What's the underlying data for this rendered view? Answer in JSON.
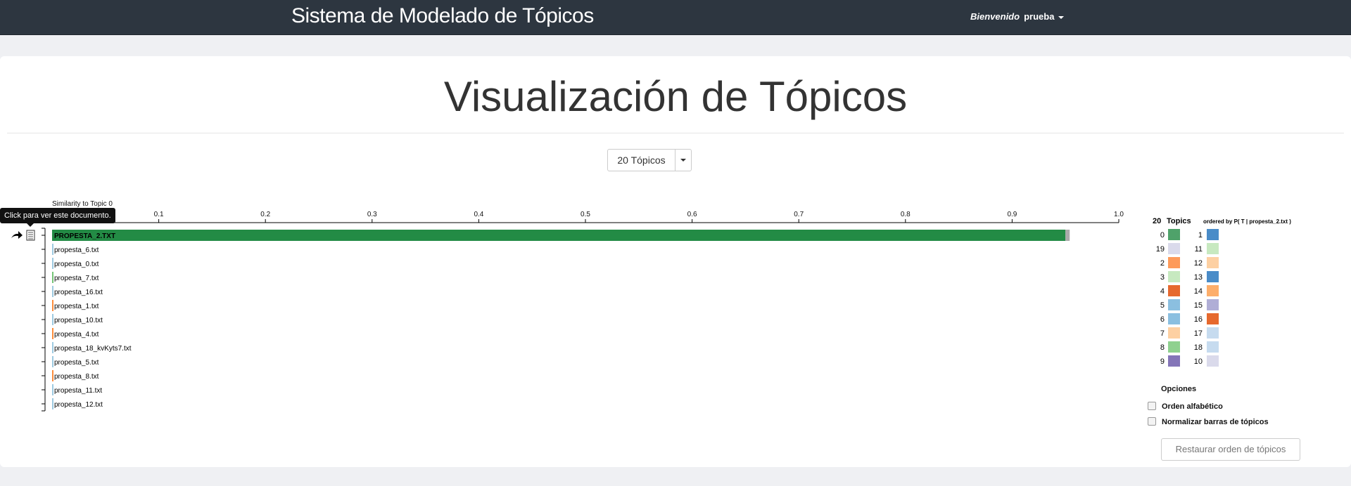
{
  "navbar": {
    "brand": "Sistema de Modelado de Tópicos",
    "welcome": "Bienvenido",
    "username": "prueba"
  },
  "page": {
    "title": "Visualización de Tópicos"
  },
  "topic_selector": {
    "selected": "20 Tópicos"
  },
  "tooltip": "Click para ver este documento.",
  "options": {
    "title": "Opciones",
    "alphabetical": "Orden alfabético",
    "normalize": "Normalizar barras de tópicos",
    "restore": "Restaurar orden de tópicos"
  },
  "colors": {
    "navbar": "#2d3640",
    "primary_bar": "#238b45"
  },
  "chart_data": {
    "type": "bar",
    "title": "Similarity to Topic 0",
    "xlim": [
      0,
      1.0
    ],
    "ticks": [
      "0.1",
      "0.2",
      "0.3",
      "0.4",
      "0.5",
      "0.6",
      "0.7",
      "0.8",
      "0.9",
      "1.0"
    ],
    "documents": [
      {
        "name": "PROPESTA_2.TXT",
        "value": 0.95,
        "color": "#238b45",
        "tail": "#aaaaaa"
      },
      {
        "name": "propesta_6.txt",
        "value": 0.001,
        "color": "#9ecae1"
      },
      {
        "name": "propesta_0.txt",
        "value": 0.001,
        "color": "#9ecae1"
      },
      {
        "name": "propesta_7.txt",
        "value": 0.001,
        "color": "#74c476"
      },
      {
        "name": "propesta_16.txt",
        "value": 0.001,
        "color": "#9ecae1"
      },
      {
        "name": "propesta_1.txt",
        "value": 0.001,
        "color": "#fd8d3c"
      },
      {
        "name": "propesta_10.txt",
        "value": 0.001,
        "color": "#9ecae1"
      },
      {
        "name": "propesta_4.txt",
        "value": 0.001,
        "color": "#fd8d3c"
      },
      {
        "name": "propesta_18_kvKyts7.txt",
        "value": 0.001,
        "color": "#9ecae1"
      },
      {
        "name": "propesta_5.txt",
        "value": 0.001,
        "color": "#9ecae1"
      },
      {
        "name": "propesta_8.txt",
        "value": 0.001,
        "color": "#fd8d3c"
      },
      {
        "name": "propesta_11.txt",
        "value": 0.001,
        "color": "#9ecae1"
      },
      {
        "name": "propesta_12.txt",
        "value": 0.001,
        "color": "#9ecae1"
      }
    ]
  },
  "legend": {
    "count": "20",
    "label": "Topics",
    "ordered_by": "ordered by P( T | propesta_2.txt )",
    "left": [
      {
        "num": "0",
        "color": "#4fa26a"
      },
      {
        "num": "19",
        "color": "#dadaeb"
      },
      {
        "num": "2",
        "color": "#fd9a5a"
      },
      {
        "num": "3",
        "color": "#c7e9c0"
      },
      {
        "num": "4",
        "color": "#e6692e"
      },
      {
        "num": "5",
        "color": "#8bbfe0"
      },
      {
        "num": "6",
        "color": "#8bbfe0"
      },
      {
        "num": "7",
        "color": "#fdd0a2"
      },
      {
        "num": "8",
        "color": "#8fd18f"
      },
      {
        "num": "9",
        "color": "#8475b8"
      }
    ],
    "right": [
      {
        "num": "1",
        "color": "#4a8cc8"
      },
      {
        "num": "11",
        "color": "#c7e9c0"
      },
      {
        "num": "12",
        "color": "#fdd0a2"
      },
      {
        "num": "13",
        "color": "#4a8cc8"
      },
      {
        "num": "14",
        "color": "#fdae6b"
      },
      {
        "num": "15",
        "color": "#b0aed6"
      },
      {
        "num": "16",
        "color": "#e6692e"
      },
      {
        "num": "17",
        "color": "#c6dbef"
      },
      {
        "num": "18",
        "color": "#c6dbef"
      },
      {
        "num": "10",
        "color": "#dadaeb"
      }
    ]
  }
}
